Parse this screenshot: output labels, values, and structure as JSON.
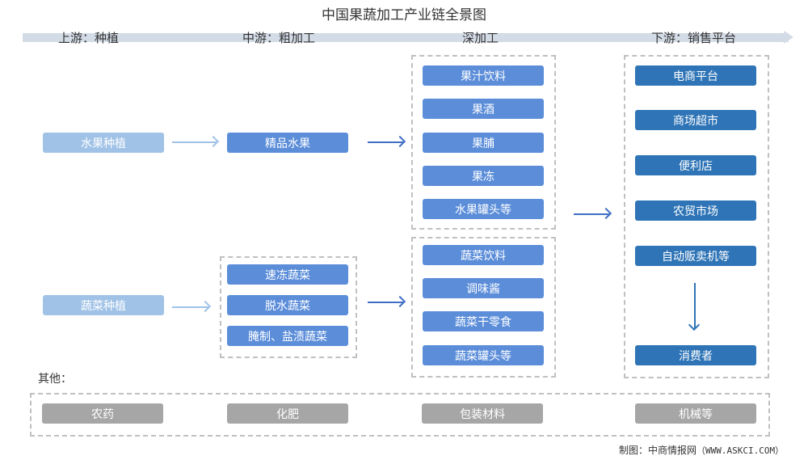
{
  "title": "中国果蔬加工产业链全景图",
  "stages": [
    {
      "label": "上游：种植"
    },
    {
      "label": "中游：粗加工"
    },
    {
      "label": "深加工"
    },
    {
      "label": "下游：销售平台"
    }
  ],
  "upstream": {
    "fruit": "水果种植",
    "vegetable": "蔬菜种植"
  },
  "midstream": {
    "fruit": "精品水果",
    "vegetable": [
      "速冻蔬菜",
      "脱水蔬菜",
      "腌制、盐渍蔬菜"
    ]
  },
  "deep_processing": {
    "fruit": [
      "果汁饮料",
      "果酒",
      "果脯",
      "果冻",
      "水果罐头等"
    ],
    "vegetable": [
      "蔬菜饮料",
      "调味酱",
      "蔬菜干零食",
      "蔬菜罐头等"
    ]
  },
  "downstream": {
    "channels": [
      "电商平台",
      "商场超市",
      "便利店",
      "农贸市场",
      "自动贩卖机等"
    ],
    "consumer": "消费者"
  },
  "others": {
    "label": "其他：",
    "items": [
      "农药",
      "化肥",
      "包装材料",
      "机械等"
    ]
  },
  "source": {
    "prefix": "制图：中商情报网",
    "url": "（WWW.ASKCI.COM）"
  },
  "colors": {
    "upstream": "#a0c2e7",
    "midstream": "#5b8dd9",
    "downstream": "#2e74b6",
    "others": "#a6a6a6",
    "stage_bar": "#d3dbe6"
  }
}
